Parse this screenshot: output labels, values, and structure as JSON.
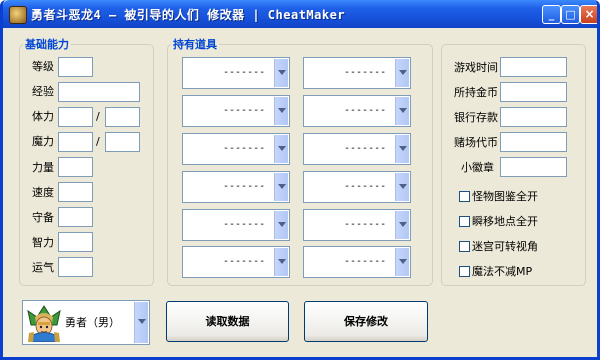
{
  "window": {
    "title": "勇者斗恶龙4 — 被引导的人们 修改器 | CheatMaker",
    "minimize": "_",
    "maximize": "□",
    "close": "×"
  },
  "basic": {
    "title": "基础能力",
    "labels": {
      "level": "等级",
      "exp": "经验",
      "hp": "体力",
      "mp": "魔力",
      "str": "力量",
      "agi": "速度",
      "def": "守备",
      "int": "智力",
      "luck": "运气"
    },
    "slash": "/"
  },
  "items": {
    "title": "持有道具",
    "slot_text": "-------"
  },
  "misc": {
    "labels": {
      "play_time": "游戏时间",
      "gold": "所持金币",
      "bank": "银行存款",
      "casino": "赌场代币",
      "medal": "小徽章"
    },
    "checks": [
      {
        "label": "怪物图鉴全开",
        "checked": false
      },
      {
        "label": "瞬移地点全开",
        "checked": false
      },
      {
        "label": "迷宫可转视角",
        "checked": false
      },
      {
        "label": "魔法不减MP",
        "checked": false
      }
    ]
  },
  "hero": {
    "selected": "勇者（男）"
  },
  "buttons": {
    "read": "读取数据",
    "save": "保存修改"
  },
  "colors": {
    "titlebar": "#1f60e8",
    "group_title": "#0046d5",
    "window_bg": "#ece9d8"
  }
}
